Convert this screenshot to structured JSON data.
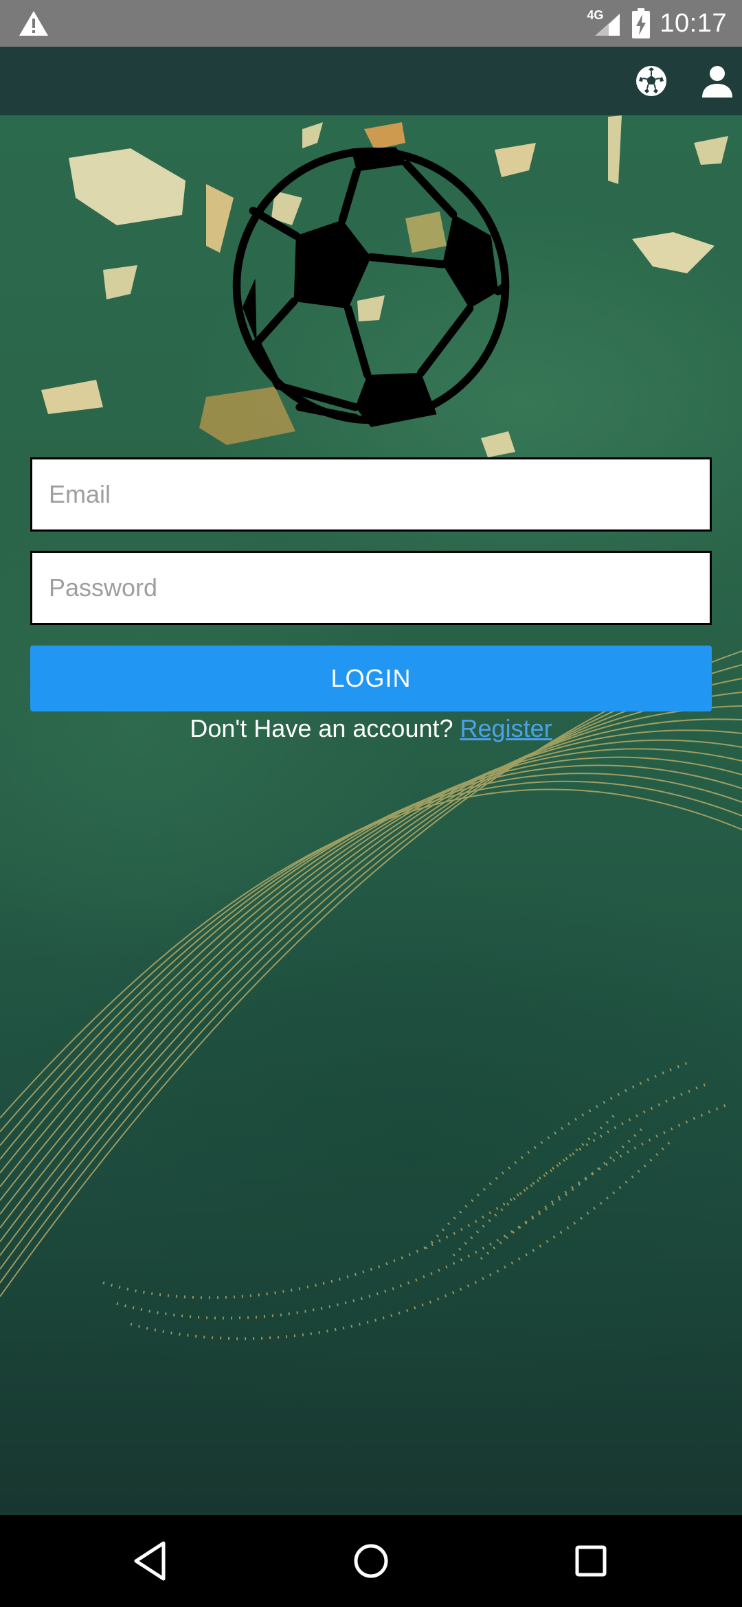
{
  "status_bar": {
    "network": "4G",
    "time": "10:17",
    "icons": [
      "warning-icon",
      "signal-icon",
      "battery-charging-icon"
    ]
  },
  "app_bar": {
    "icons": [
      "soccer-ball-icon",
      "person-icon"
    ]
  },
  "login_form": {
    "email_placeholder": "Email",
    "email_value": "",
    "password_placeholder": "Password",
    "password_value": "",
    "login_label": "LOGIN",
    "register_prompt": "Don't Have an account?",
    "register_link": "Register"
  },
  "nav_bar": {
    "icons": [
      "back-icon",
      "home-icon",
      "recents-icon"
    ]
  },
  "colors": {
    "status_bar": "#7a7a7a",
    "app_bar": "#1f3d3b",
    "login_button": "#2196f3",
    "register_link": "#4aa3e8",
    "background": "#2a6449"
  }
}
